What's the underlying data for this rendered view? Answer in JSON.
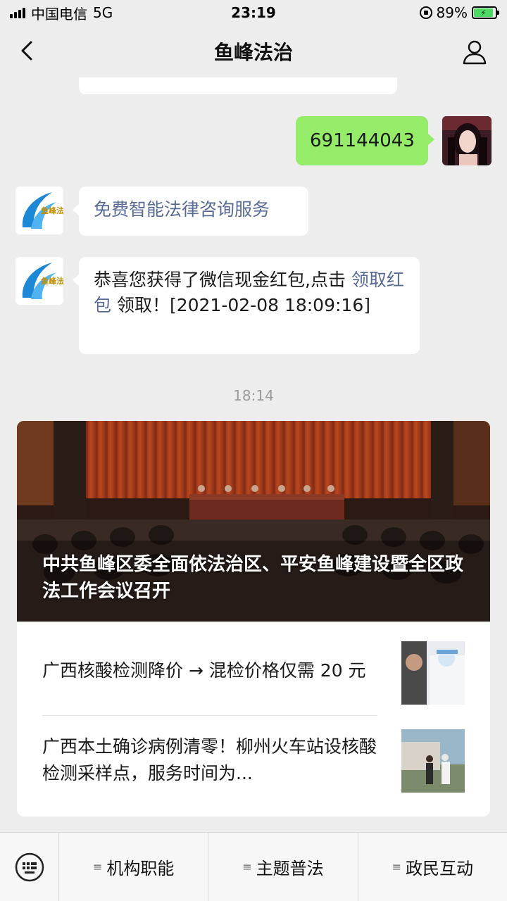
{
  "status_bar": {
    "carrier": "中国电信",
    "network": "5G",
    "time": "23:19",
    "battery": "89%"
  },
  "nav": {
    "title": "鱼峰法治",
    "back_icon": "chevron-left-icon",
    "profile_icon": "person-icon"
  },
  "chat": {
    "messages": [
      {
        "side": "right",
        "text": "691144043"
      },
      {
        "side": "left",
        "text": "免费智能法律咨询服务",
        "link": true
      },
      {
        "side": "left",
        "text_before": "恭喜您获得了微信现金红包,点击 ",
        "link_text": "领取红包",
        "text_after": " 领取！[2021-02-08 18:09:16]"
      }
    ],
    "timestamp": "18:14",
    "account_logo_text": "鱼峰法治"
  },
  "article_card": {
    "hero_title": "中共鱼峰区委全面依法治区、平安鱼峰建设暨全区政法工作会议召开",
    "items": [
      {
        "title": "广西核酸检测降价 → 混检价格仅需 20 元"
      },
      {
        "title": "广西本土确诊病例清零！柳州火车站设核酸检测采样点，服务时间为..."
      }
    ]
  },
  "bottom_menu": {
    "keyboard_icon": "keyboard-icon",
    "menu_glyph": "≡",
    "items": [
      {
        "label": "机构职能"
      },
      {
        "label": "主题普法"
      },
      {
        "label": "政民互动"
      }
    ]
  },
  "colors": {
    "background": "#ededed",
    "user_bubble": "#95ec69",
    "link": "#576b95"
  }
}
